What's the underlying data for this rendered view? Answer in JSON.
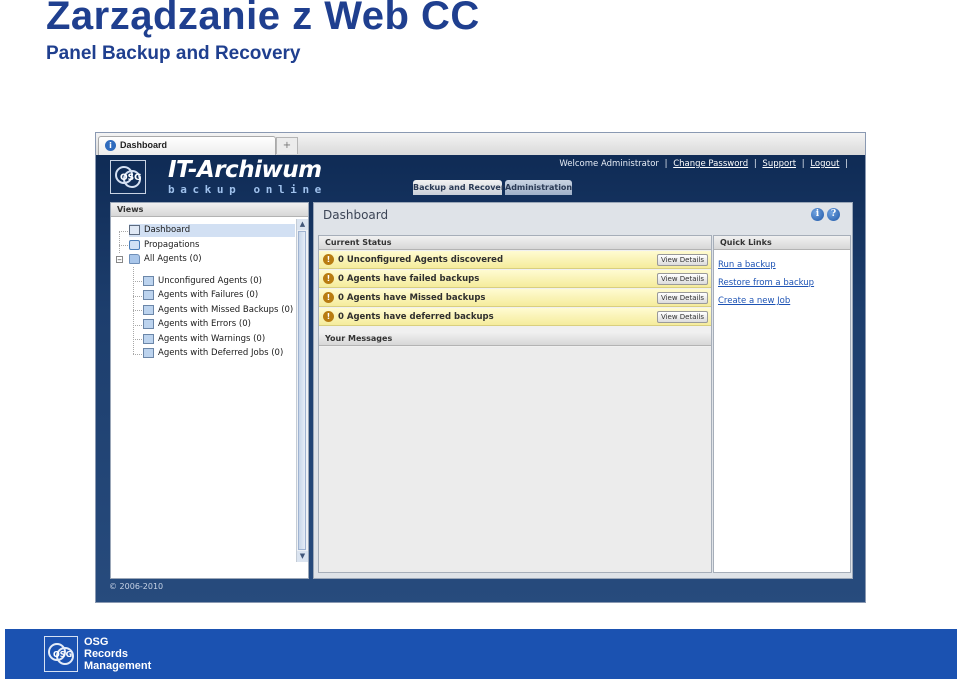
{
  "slide": {
    "title": "Zarządzanie z Web CC",
    "subtitle": "Panel Backup and Recovery"
  },
  "browser": {
    "tab_label": "Dashboard",
    "new_tab_symbol": "+"
  },
  "header": {
    "brand": "IT-Archiwum",
    "brand_tagline": "backup online",
    "logo_text": "OSG",
    "welcome": "Welcome Administrator",
    "sep": "|",
    "links": [
      "Change Password",
      "Support",
      "Logout"
    ]
  },
  "main_tabs": [
    "Backup and Recovery",
    "Administration"
  ],
  "views": {
    "title": "Views",
    "items": [
      "Dashboard",
      "Propagations",
      "All Agents (0)",
      "Unconfigured Agents (0)",
      "Agents with Failures (0)",
      "Agents with Missed Backups (0)",
      "Agents with Errors (0)",
      "Agents with Warnings (0)",
      "Agents with Deferred Jobs (0)"
    ],
    "expander": "−",
    "scroll_up": "▲",
    "scroll_down": "▼"
  },
  "dashboard": {
    "title": "Dashboard",
    "info_icon": "i",
    "help_icon": "?",
    "current_status": {
      "title": "Current Status",
      "warning_glyph": "!",
      "rows": [
        {
          "text": "0 Unconfigured Agents discovered",
          "button": "View Details"
        },
        {
          "text": "0 Agents have failed backups",
          "button": "View Details"
        },
        {
          "text": "0 Agents have Missed backups",
          "button": "View Details"
        },
        {
          "text": "0 Agents have deferred backups",
          "button": "View Details"
        }
      ]
    },
    "messages_title": "Your Messages",
    "quick_links": {
      "title": "Quick Links",
      "links": [
        "Run a backup",
        "Restore from a backup",
        "Create a new Job"
      ]
    }
  },
  "app_footer": {
    "copyright": "© 2006-2010"
  },
  "footer": {
    "logo_text": "OSG",
    "lines": [
      "OSG",
      "Records",
      "Management"
    ]
  },
  "colors": {
    "title_blue": "#1f3f8f",
    "footer_blue": "#1b52b1",
    "status_yellow": "#f5ec9c",
    "link_blue": "#1d53b4"
  }
}
